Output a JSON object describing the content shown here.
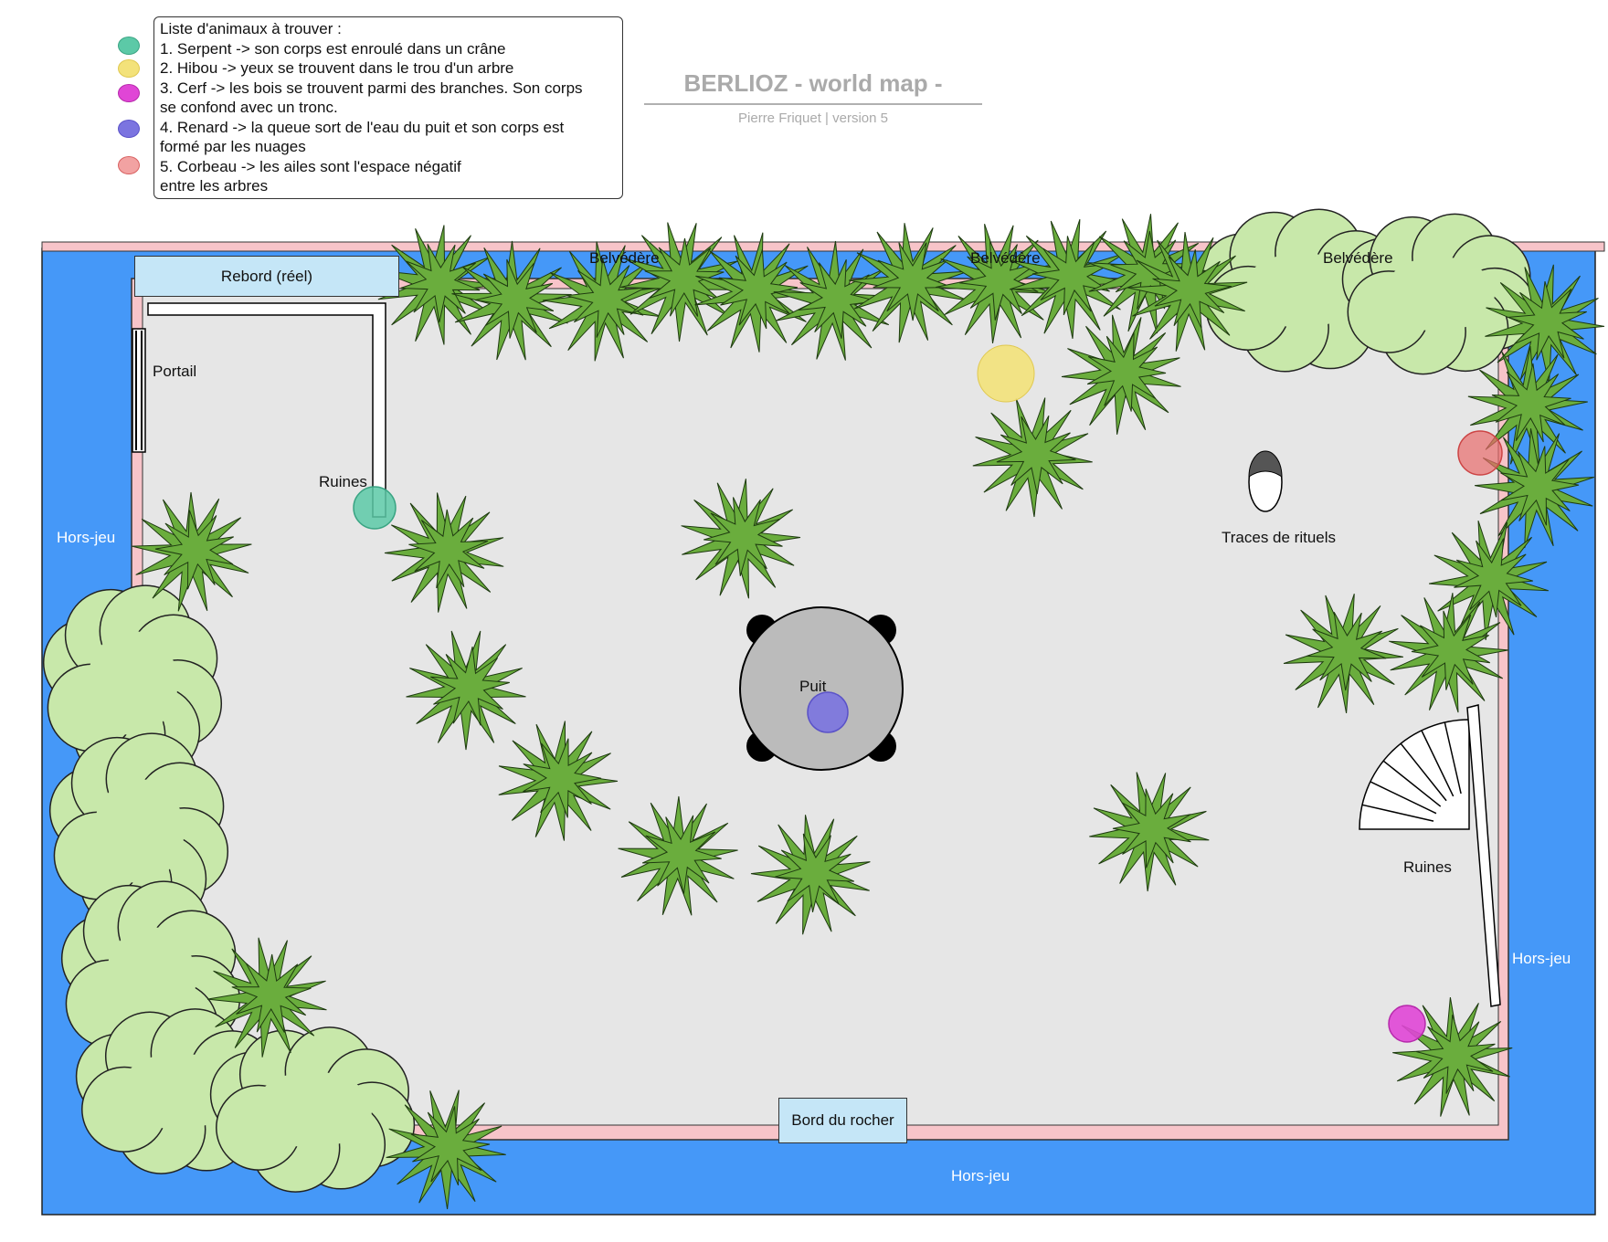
{
  "header": {
    "title": "BERLIOZ - world map -",
    "subtitle": "Pierre Friquet  |  version 5"
  },
  "legend": {
    "heading": "Liste d'animaux à trouver :",
    "lines": [
      "1. Serpent -> son corps est enroulé dans un crâne",
      "2. Hibou -> yeux se trouvent dans le trou d'un arbre",
      "3. Cerf -> les bois se trouvent parmi des branches. Son corps",
      "se confond avec un tronc.",
      "4. Renard -> la queue sort de l'eau du puit et son corps est",
      "formé par les nuages",
      "5. Corbeau -> les ailes sont l'espace négatif",
      "entre les arbres"
    ],
    "markers": [
      {
        "animal": "Serpent",
        "color": "#5cc9a7"
      },
      {
        "animal": "Hibou",
        "color": "#f3e27a"
      },
      {
        "animal": "Cerf",
        "color": "#e046d6"
      },
      {
        "animal": "Renard",
        "color": "#7b74e0"
      },
      {
        "animal": "Corbeau",
        "color": "#f2a2a2"
      }
    ]
  },
  "map": {
    "colors": {
      "water": "#4598f8",
      "ground": "#e6e6e6",
      "border": "#f7c4c9",
      "tree": "#6aad3d",
      "bush": "#c8e8aa",
      "well": "#bbbbbb",
      "label_box": "#c5e6f7"
    },
    "labels": {
      "rebord": "Rebord (réel)",
      "belvedere_1": "Belvédère",
      "belvedere_2": "Belvédère",
      "belvedere_3": "Belvédère",
      "portail": "Portail",
      "ruines_left": "Ruines",
      "hors_jeu_left": "Hors-jeu",
      "hors_jeu_right": "Hors-jeu",
      "hors_jeu_bottom": "Hors-jeu",
      "puit": "Puit",
      "traces": "Traces de rituels",
      "ruines_right": "Ruines",
      "bord_rocher": "Bord du rocher"
    }
  }
}
